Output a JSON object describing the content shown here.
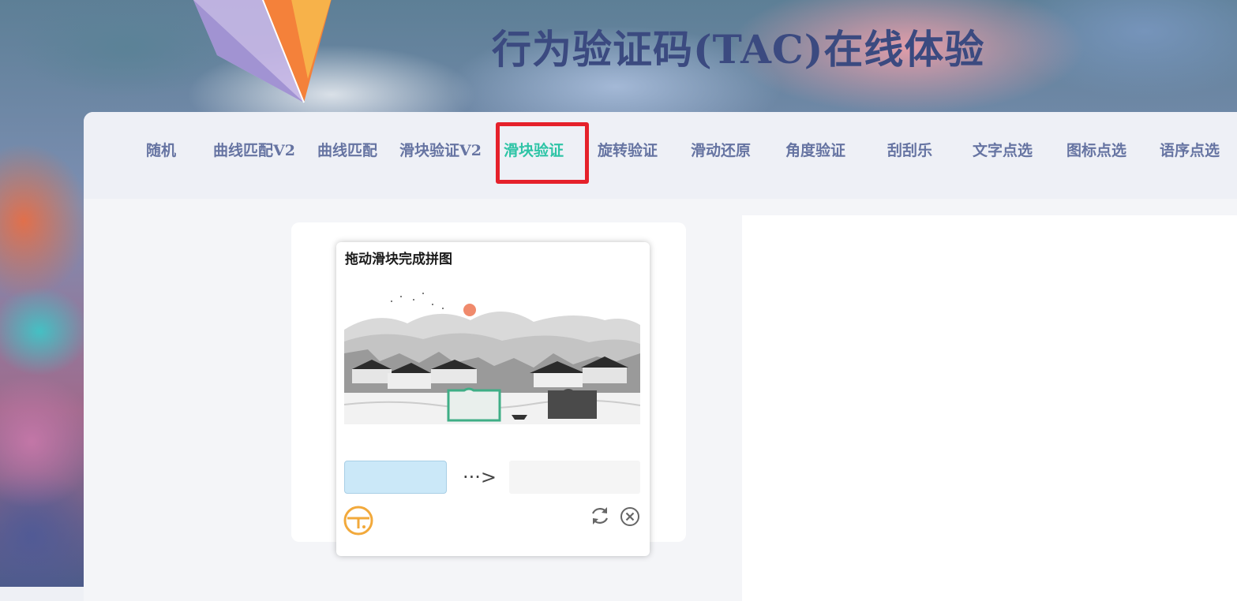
{
  "page": {
    "title": "行为验证码(TAC)在线体验"
  },
  "nav": {
    "items": [
      {
        "label": "随机"
      },
      {
        "label": "曲线匹配V2"
      },
      {
        "label": "曲线匹配"
      },
      {
        "label": "滑块验证V2"
      },
      {
        "label": "滑块验证"
      },
      {
        "label": "旋转验证"
      },
      {
        "label": "滑动还原"
      },
      {
        "label": "角度验证"
      },
      {
        "label": "刮刮乐"
      },
      {
        "label": "文字点选"
      },
      {
        "label": "图标点选"
      },
      {
        "label": "语序点选"
      }
    ],
    "active_label": "滑块验证",
    "active_color": "#2ec4a6",
    "highlight_color": "#e5212b"
  },
  "captcha": {
    "title": "拖动滑块完成拼图",
    "slider_arrow": "···>",
    "logo_icon": "tac-logo-icon",
    "refresh_icon": "refresh-icon",
    "close_icon": "close-icon"
  }
}
